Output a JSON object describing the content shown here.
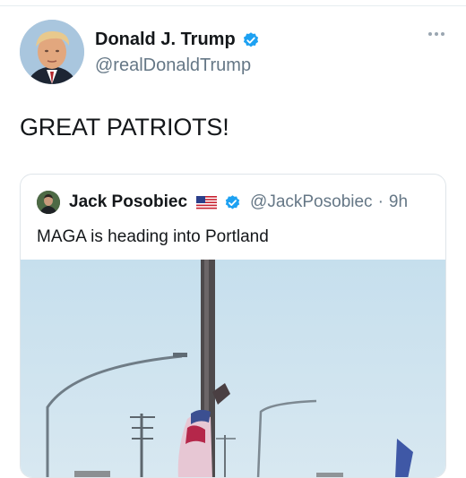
{
  "tweet": {
    "display_name": "Donald J. Trump",
    "handle": "@realDonaldTrump",
    "text": "GREAT PATRIOTS!",
    "verified_icon": "verified-badge-icon",
    "more_icon": "more-options-icon"
  },
  "quoted": {
    "display_name": "Jack Posobiec",
    "flag_icon": "us-flag-icon",
    "handle": "@JackPosobiec",
    "separator": "·",
    "time": "9h",
    "text": "MAGA is heading into Portland"
  },
  "colors": {
    "verified_blue": "#1da1f2",
    "handle_gray": "#657786",
    "border": "#dfe5ea",
    "sky": "#c9e0ee"
  }
}
